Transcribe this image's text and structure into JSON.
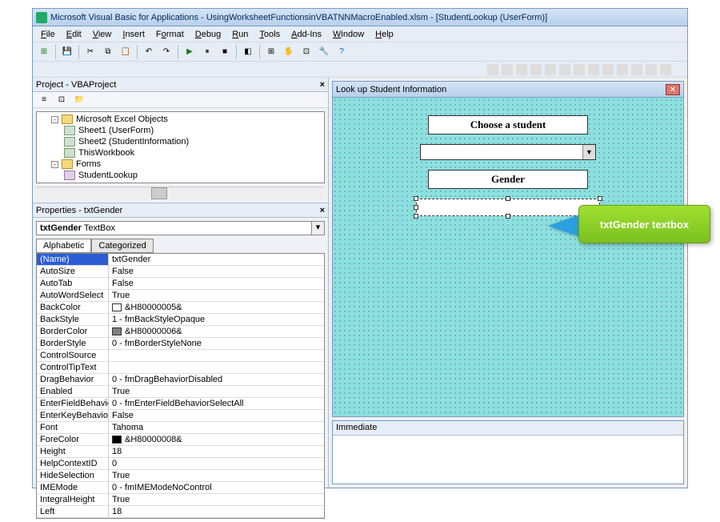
{
  "title": "Microsoft Visual Basic for Applications - UsingWorksheetFunctionsinVBATNNMacroEnabled.xlsm - [StudentLookup (UserForm)]",
  "menu": [
    "File",
    "Edit",
    "View",
    "Insert",
    "Format",
    "Debug",
    "Run",
    "Tools",
    "Add-Ins",
    "Window",
    "Help"
  ],
  "project": {
    "title": "Project - VBAProject",
    "nodes": {
      "excelObjects": "Microsoft Excel Objects",
      "sheet1": "Sheet1 (UserForm)",
      "sheet2": "Sheet2 (StudentInformation)",
      "thisWb": "ThisWorkbook",
      "forms": "Forms",
      "studentLookup": "StudentLookup"
    }
  },
  "props": {
    "title": "Properties - txtGender",
    "combo": "txtGender TextBox",
    "tabs": {
      "a": "Alphabetic",
      "c": "Categorized"
    },
    "rows": [
      {
        "n": "(Name)",
        "v": "txtGender",
        "sel": true
      },
      {
        "n": "AutoSize",
        "v": "False"
      },
      {
        "n": "AutoTab",
        "v": "False"
      },
      {
        "n": "AutoWordSelect",
        "v": "True"
      },
      {
        "n": "BackColor",
        "v": "&H80000005&",
        "sw": "#ffffff"
      },
      {
        "n": "BackStyle",
        "v": "1 - fmBackStyleOpaque"
      },
      {
        "n": "BorderColor",
        "v": "&H80000006&",
        "sw": "#808080"
      },
      {
        "n": "BorderStyle",
        "v": "0 - fmBorderStyleNone"
      },
      {
        "n": "ControlSource",
        "v": ""
      },
      {
        "n": "ControlTipText",
        "v": ""
      },
      {
        "n": "DragBehavior",
        "v": "0 - fmDragBehaviorDisabled"
      },
      {
        "n": "Enabled",
        "v": "True"
      },
      {
        "n": "EnterFieldBehavior",
        "v": "0 - fmEnterFieldBehaviorSelectAll"
      },
      {
        "n": "EnterKeyBehavior",
        "v": "False"
      },
      {
        "n": "Font",
        "v": "Tahoma"
      },
      {
        "n": "ForeColor",
        "v": "&H80000008&",
        "sw": "#000000"
      },
      {
        "n": "Height",
        "v": "18"
      },
      {
        "n": "HelpContextID",
        "v": "0"
      },
      {
        "n": "HideSelection",
        "v": "True"
      },
      {
        "n": "IMEMode",
        "v": "0 - fmIMEModeNoControl"
      },
      {
        "n": "IntegralHeight",
        "v": "True"
      },
      {
        "n": "Left",
        "v": "18"
      }
    ]
  },
  "userform": {
    "title": "Look up Student Information",
    "label1": "Choose a student",
    "label2": "Gender"
  },
  "immediate": {
    "title": "Immediate"
  },
  "callout": "txtGender textbox"
}
